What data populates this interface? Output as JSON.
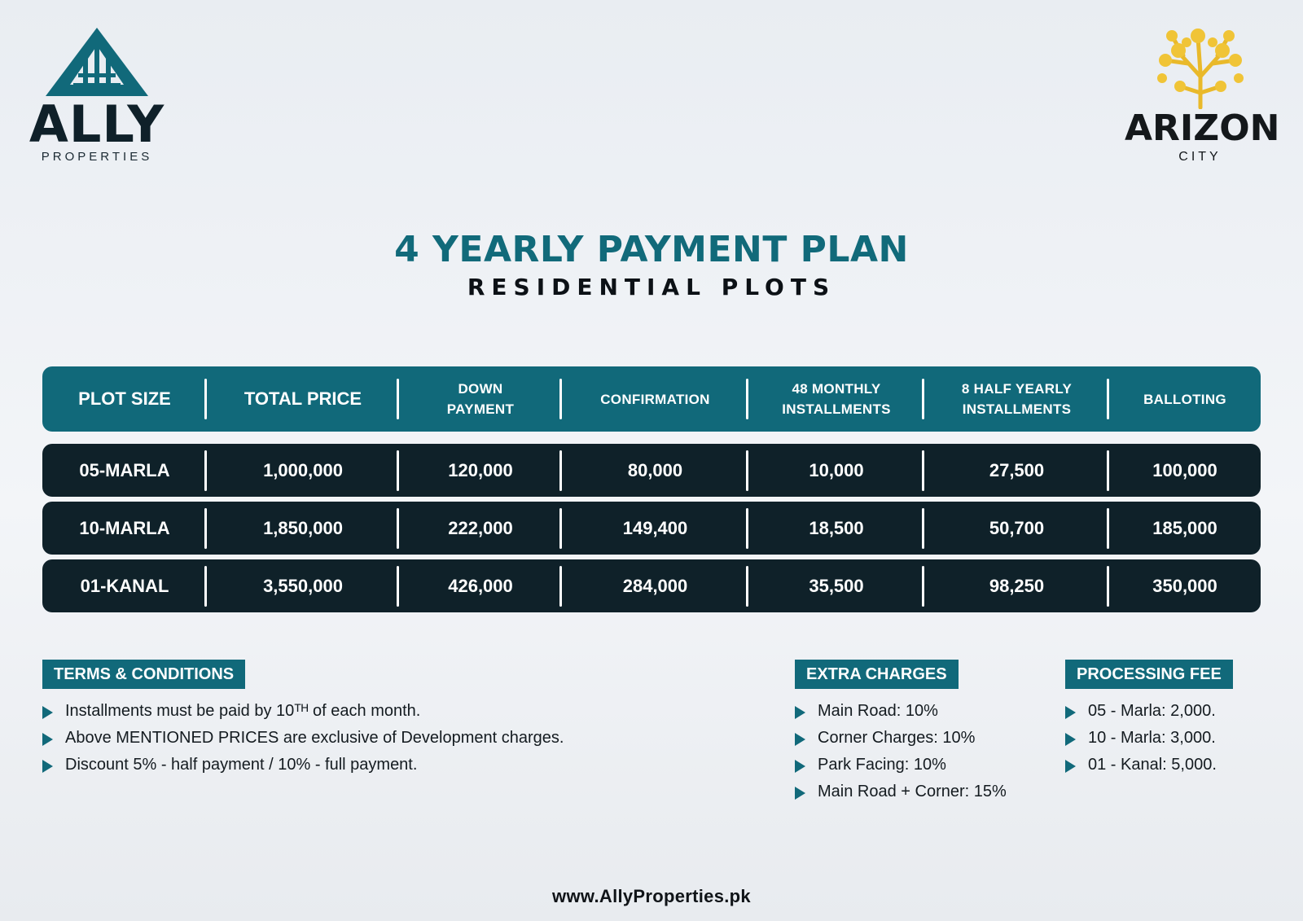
{
  "brand_left": {
    "name": "ALLY",
    "subtitle": "PROPERTIES"
  },
  "brand_right": {
    "name": "ARIZON",
    "subtitle": "CITY"
  },
  "heading": {
    "title": "4 YEARLY PAYMENT PLAN",
    "subtitle": "RESIDENTIAL PLOTS"
  },
  "table": {
    "headers": [
      "PLOT SIZE",
      "TOTAL PRICE",
      "DOWN PAYMENT",
      "CONFIRMATION",
      "48 MONTHLY INSTALLMENTS",
      "8 HALF YEARLY INSTALLMENTS",
      "BALLOTING"
    ],
    "rows": [
      [
        "05-MARLA",
        "1,000,000",
        "120,000",
        "80,000",
        "10,000",
        "27,500",
        "100,000"
      ],
      [
        "10-MARLA",
        "1,850,000",
        "222,000",
        "149,400",
        "18,500",
        "50,700",
        "185,000"
      ],
      [
        "01-KANAL",
        "3,550,000",
        "426,000",
        "284,000",
        "35,500",
        "98,250",
        "350,000"
      ]
    ]
  },
  "terms": {
    "label": "TERMS & CONDITIONS",
    "items": [
      "Installments must be paid by 10ᵀᴴ of each month.",
      "Above MENTIONED PRICES are exclusive of Development charges.",
      "Discount 5% - half payment / 10% - full payment."
    ]
  },
  "extra_charges": {
    "label": "EXTRA CHARGES",
    "items": [
      "Main Road: 10%",
      "Corner Charges: 10%",
      "Park Facing: 10%",
      "Main Road + Corner: 15%"
    ]
  },
  "processing_fee": {
    "label": "PROCESSING FEE",
    "items": [
      "05 - Marla: 2,000.",
      "10 - Marla: 3,000.",
      "01 - Kanal: 5,000."
    ]
  },
  "footer": {
    "website": "www.AllyProperties.pk"
  },
  "colors": {
    "teal": "#11697a",
    "dark_row": "#0f2129",
    "gold": "#e9b92a"
  },
  "icons": {
    "left_logo": "triangle-logo-icon",
    "right_logo": "golden-tree-icon",
    "bullet": "triangle-arrow-icon"
  }
}
